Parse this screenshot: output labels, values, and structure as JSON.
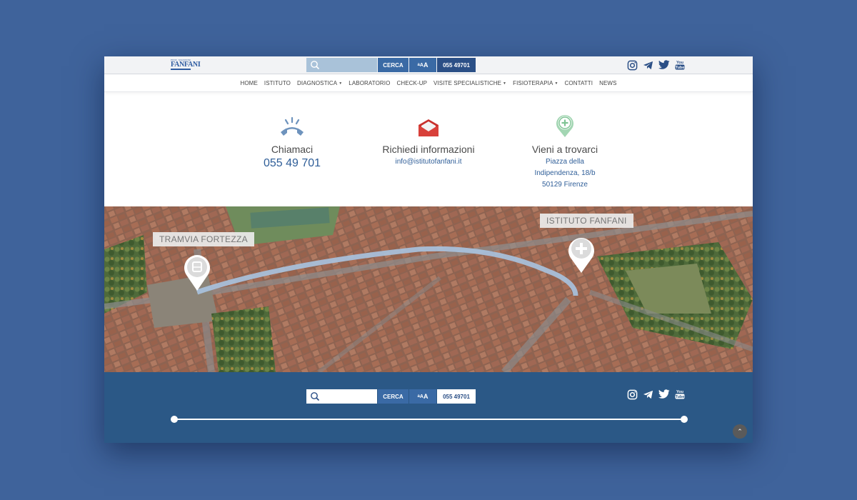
{
  "header": {
    "logo": {
      "small": "PROF. SIGNORINI",
      "big": "FANFANI",
      "sub": "ISTITUTO"
    },
    "search": {
      "placeholder": "",
      "cerca_label": "CERCA",
      "aaa": [
        "a",
        "A",
        "A"
      ],
      "phone_label": "055 49701"
    }
  },
  "nav": {
    "items": [
      {
        "label": "HOME",
        "dropdown": false
      },
      {
        "label": "ISTITUTO",
        "dropdown": false
      },
      {
        "label": "DIAGNOSTICA",
        "dropdown": true
      },
      {
        "label": "LABORATORIO",
        "dropdown": false
      },
      {
        "label": "CHECK-UP",
        "dropdown": false
      },
      {
        "label": "VISITE SPECIALISTICHE",
        "dropdown": true
      },
      {
        "label": "FISIOTERAPIA",
        "dropdown": true
      },
      {
        "label": "CONTATTI",
        "dropdown": false
      },
      {
        "label": "NEWS",
        "dropdown": false
      }
    ],
    "caret": "▼"
  },
  "contacts": {
    "call": {
      "title": "Chiamaci",
      "phone": "055 49 701",
      "icon": "phone-icon"
    },
    "info": {
      "title": "Richiedi informazioni",
      "email": "info@istitutofanfani.it",
      "icon": "envelope-icon"
    },
    "visit": {
      "title": "Vieni a trovarci",
      "line1": "Piazza della",
      "line2": "Indipendenza, 18/b",
      "line3": "50129 Firenze",
      "icon": "location-plus-icon"
    }
  },
  "map": {
    "tram_label": "TRAMVIA FORTEZZA",
    "institute_label": "ISTITUTO FANFANI"
  },
  "footer": {
    "search": {
      "placeholder": "",
      "cerca_label": "CERCA",
      "aaa": [
        "a",
        "A",
        "A"
      ],
      "phone_label": "055 49701"
    },
    "to_top": "⌃"
  },
  "colors": {
    "page_bg": "#3f639b",
    "accent": "#3a6aa5",
    "dark_blue": "#2b4f86",
    "footer": "#2b5886",
    "envelope_red": "#c8302c",
    "pin_green": "#8fc9a2"
  }
}
